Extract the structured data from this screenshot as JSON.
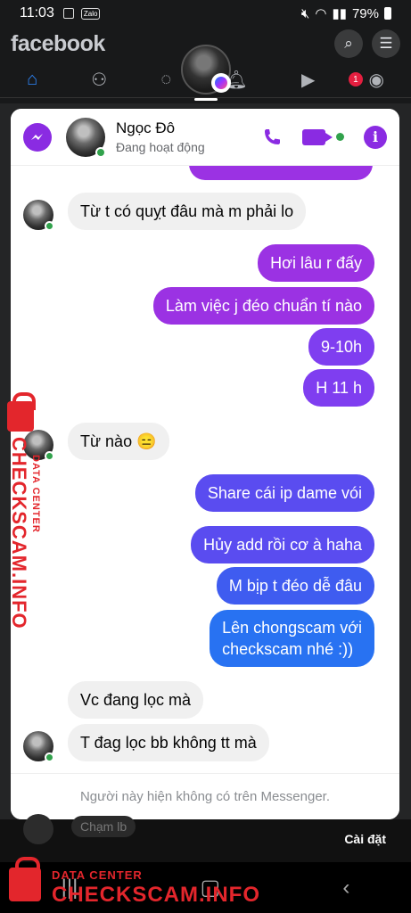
{
  "status_bar": {
    "time": "11:03",
    "zalo": "Zalo",
    "battery": "79%"
  },
  "fb": {
    "logo": "facebook",
    "notif_count": "1",
    "settings": "Cài đặt"
  },
  "chat": {
    "name": "Ngọc Đô",
    "status": "Đang hoạt động",
    "footer": "Người này hiện không có trên Messenger."
  },
  "messages": [
    {
      "dir": "in",
      "text": "Từ t có quỵt đâu mà m phải lo"
    },
    {
      "dir": "out",
      "text": "Hơi lâu r đấy"
    },
    {
      "dir": "out",
      "text": "Làm việc j đéo chuẩn tí nào"
    },
    {
      "dir": "out",
      "text": "9-10h"
    },
    {
      "dir": "out",
      "text": "H 11 h"
    },
    {
      "dir": "in",
      "text": "Từ nào 😑"
    },
    {
      "dir": "out",
      "text": "Share cái ip dame vói"
    },
    {
      "dir": "out",
      "text": "Hủy add rồi cơ à haha"
    },
    {
      "dir": "out",
      "text": "M bịp t đéo dễ đâu"
    },
    {
      "dir": "out",
      "text": "Lên chongscam với"
    },
    {
      "dir": "out",
      "text": "checkscam nhé :))"
    },
    {
      "dir": "in",
      "text": "Vc đang lọc mà"
    },
    {
      "dir": "in",
      "text": "T đag lọc bb không tt mà"
    }
  ],
  "behind": {
    "chat_preview": "Chạm lb"
  },
  "watermark": {
    "line1": "DATA CENTER",
    "line2": "CHECKSCAM.INFO"
  },
  "colors": {
    "accent": "#8a2be2",
    "online": "#31a24c",
    "brand": "#2d88ff"
  }
}
